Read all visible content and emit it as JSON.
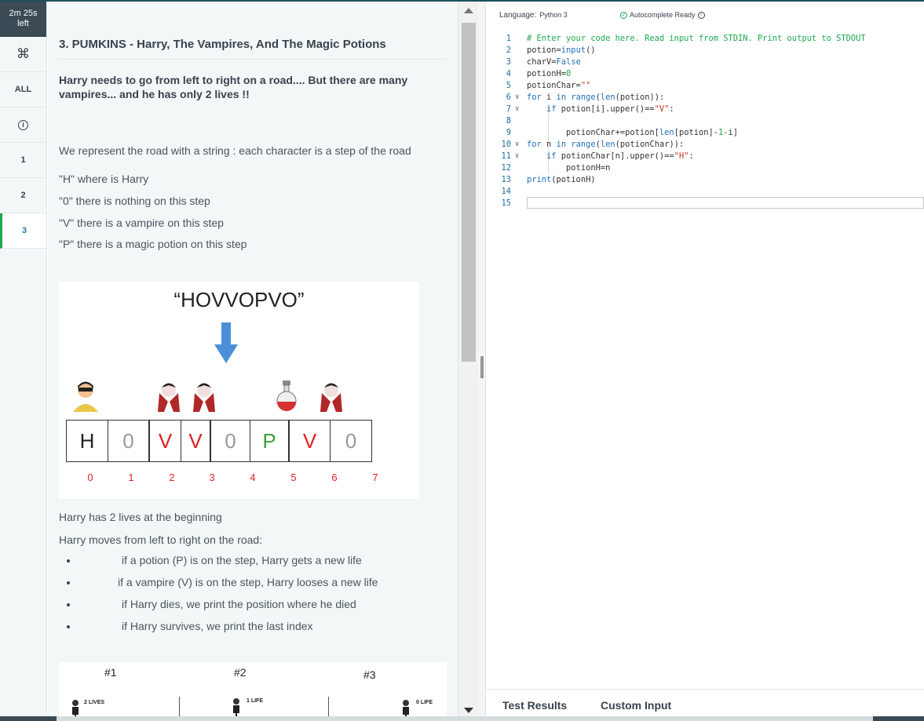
{
  "timer": {
    "line1": "2m 25s",
    "line2": "left"
  },
  "sidebar": {
    "items": [
      {
        "label": "⌘",
        "icon": "command-icon"
      },
      {
        "label": "ALL"
      },
      {
        "label": "i",
        "icon": "info-icon"
      },
      {
        "label": "1"
      },
      {
        "label": "2"
      },
      {
        "label": "3",
        "active": true
      }
    ]
  },
  "problem": {
    "title": "3. PUMKINS - Harry, The Vampires, And The Magic Potions",
    "intro": "Harry needs to go from left to right on a road.... But there are many vampires... and he has only 2 lives !!",
    "road_desc": "We represent the road with a string : each character is a step of the road",
    "legend": [
      "\"H\" where is Harry",
      "\"0\"  there is nothing on this step",
      "\"V\"  there is a vampire on this step",
      "\"P\"  there is a magic potion on this step"
    ],
    "image": {
      "road_string": "“HOVVOPVO”",
      "cells": [
        "H",
        "0",
        "V",
        "V",
        "0",
        "P",
        "V",
        "0"
      ],
      "indices": [
        "0",
        "1",
        "2",
        "3",
        "4",
        "5",
        "6",
        "7"
      ]
    },
    "lives_text": "Harry has 2 lives at the beginning",
    "moves_text": "Harry moves from left to right on the road:",
    "bullets": [
      "if  a potion (P) is on the step, Harry gets a new life",
      "if  a vampire (V) is on the step, Harry looses a new life",
      "if Harry dies, we print the position where he died",
      "if Harry survives, we print the last index"
    ],
    "image2": {
      "labels": [
        "#1",
        "#2",
        "#3"
      ],
      "small": [
        "2 LIVES",
        "1 LIFE",
        "0 LIFE"
      ]
    }
  },
  "editor": {
    "language_label": "Language:",
    "language": "Python 3",
    "autocomplete": "Autocomplete Ready",
    "lines": [
      "1",
      "2",
      "3",
      "4",
      "5",
      "6",
      "7",
      "8",
      "9",
      "10",
      "11",
      "12",
      "13",
      "14",
      "15"
    ]
  },
  "bottom": {
    "tab1": "Test Results",
    "tab2": "Custom Input"
  }
}
